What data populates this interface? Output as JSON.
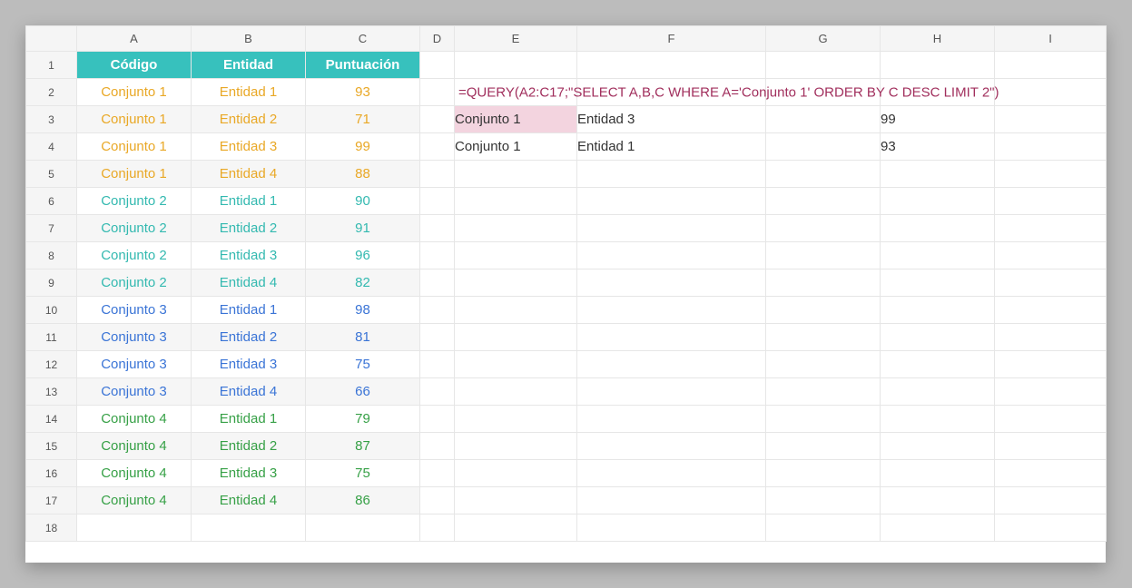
{
  "columns": [
    "A",
    "B",
    "C",
    "D",
    "E",
    "F",
    "G",
    "H",
    "I"
  ],
  "row_numbers": [
    1,
    2,
    3,
    4,
    5,
    6,
    7,
    8,
    9,
    10,
    11,
    12,
    13,
    14,
    15,
    16,
    17,
    18
  ],
  "headers": {
    "A": "Código",
    "B": "Entidad",
    "C": "Puntuación"
  },
  "data_rows": [
    {
      "codigo": "Conjunto 1",
      "entidad": "Entidad 1",
      "punt": "93",
      "cls": "cj1"
    },
    {
      "codigo": "Conjunto 1",
      "entidad": "Entidad 2",
      "punt": "71",
      "cls": "cj1"
    },
    {
      "codigo": "Conjunto 1",
      "entidad": "Entidad 3",
      "punt": "99",
      "cls": "cj1"
    },
    {
      "codigo": "Conjunto 1",
      "entidad": "Entidad 4",
      "punt": "88",
      "cls": "cj1"
    },
    {
      "codigo": "Conjunto 2",
      "entidad": "Entidad 1",
      "punt": "90",
      "cls": "cj2"
    },
    {
      "codigo": "Conjunto 2",
      "entidad": "Entidad 2",
      "punt": "91",
      "cls": "cj2"
    },
    {
      "codigo": "Conjunto 2",
      "entidad": "Entidad 3",
      "punt": "96",
      "cls": "cj2"
    },
    {
      "codigo": "Conjunto 2",
      "entidad": "Entidad 4",
      "punt": "82",
      "cls": "cj2"
    },
    {
      "codigo": "Conjunto 3",
      "entidad": "Entidad 1",
      "punt": "98",
      "cls": "cj3"
    },
    {
      "codigo": "Conjunto 3",
      "entidad": "Entidad 2",
      "punt": "81",
      "cls": "cj3"
    },
    {
      "codigo": "Conjunto 3",
      "entidad": "Entidad 3",
      "punt": "75",
      "cls": "cj3"
    },
    {
      "codigo": "Conjunto 3",
      "entidad": "Entidad 4",
      "punt": "66",
      "cls": "cj3"
    },
    {
      "codigo": "Conjunto 4",
      "entidad": "Entidad 1",
      "punt": "79",
      "cls": "cj4"
    },
    {
      "codigo": "Conjunto 4",
      "entidad": "Entidad 2",
      "punt": "87",
      "cls": "cj4"
    },
    {
      "codigo": "Conjunto 4",
      "entidad": "Entidad 3",
      "punt": "75",
      "cls": "cj4"
    },
    {
      "codigo": "Conjunto 4",
      "entidad": "Entidad 4",
      "punt": "86",
      "cls": "cj4"
    }
  ],
  "formula": "=QUERY(A2:C17;\"SELECT A,B,C WHERE A='Conjunto 1' ORDER BY C DESC LIMIT 2\")",
  "query_result": [
    {
      "codigo": "Conjunto 1",
      "entidad": "Entidad 3",
      "punt": "99",
      "highlight": true
    },
    {
      "codigo": "Conjunto 1",
      "entidad": "Entidad 1",
      "punt": "93",
      "highlight": false
    }
  ],
  "colors": {
    "header_bg": "#37c1bd",
    "formula_text": "#a12f5d",
    "pink_highlight": "#f3d4df",
    "cj1": "#e9a826",
    "cj2": "#33b9b0",
    "cj3": "#3a74d6",
    "cj4": "#36a046"
  },
  "chart_data": {
    "type": "table",
    "title": "Puntuación por Código y Entidad",
    "columns": [
      "Código",
      "Entidad",
      "Puntuación"
    ],
    "rows": [
      [
        "Conjunto 1",
        "Entidad 1",
        93
      ],
      [
        "Conjunto 1",
        "Entidad 2",
        71
      ],
      [
        "Conjunto 1",
        "Entidad 3",
        99
      ],
      [
        "Conjunto 1",
        "Entidad 4",
        88
      ],
      [
        "Conjunto 2",
        "Entidad 1",
        90
      ],
      [
        "Conjunto 2",
        "Entidad 2",
        91
      ],
      [
        "Conjunto 2",
        "Entidad 3",
        96
      ],
      [
        "Conjunto 2",
        "Entidad 4",
        82
      ],
      [
        "Conjunto 3",
        "Entidad 1",
        98
      ],
      [
        "Conjunto 3",
        "Entidad 2",
        81
      ],
      [
        "Conjunto 3",
        "Entidad 3",
        75
      ],
      [
        "Conjunto 3",
        "Entidad 4",
        66
      ],
      [
        "Conjunto 4",
        "Entidad 1",
        79
      ],
      [
        "Conjunto 4",
        "Entidad 2",
        87
      ],
      [
        "Conjunto 4",
        "Entidad 3",
        75
      ],
      [
        "Conjunto 4",
        "Entidad 4",
        86
      ]
    ]
  }
}
